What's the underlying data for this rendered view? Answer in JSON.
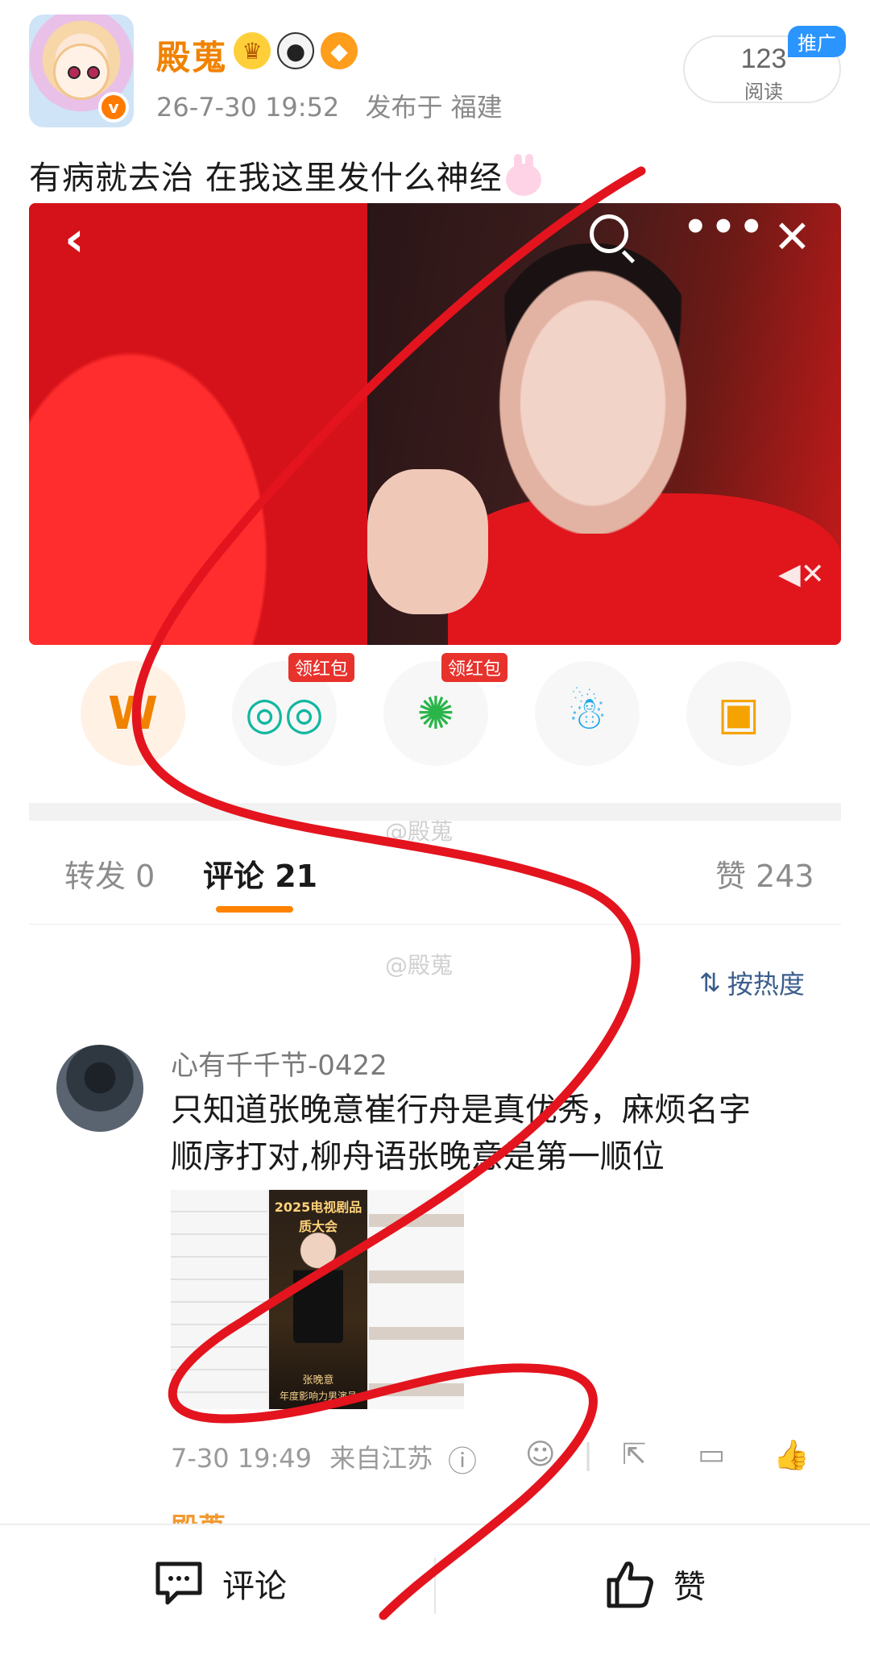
{
  "post": {
    "username": "殿蒐",
    "time": "26-7-30 19:52",
    "location": "发布于 福建",
    "reads_count": "123",
    "reads_label": "阅读",
    "promo_tag": "推广",
    "text": "有病就去治 在我这里发什么神经",
    "icons": [
      "crown-icon",
      "panda-icon",
      "fish-icon",
      "bunny-emoji"
    ]
  },
  "video": {
    "icons": [
      "back-icon",
      "search-icon",
      "more-icon",
      "close-icon",
      "mute-icon"
    ]
  },
  "share": {
    "red_packet_label": "领红包",
    "items": [
      "weibo-share-icon",
      "wechat-icon",
      "moments-icon",
      "qq-icon",
      "save-image-icon"
    ]
  },
  "watermark": "@殿蒐",
  "tabs": {
    "repost": "转发 0",
    "comments": "评论 21",
    "likes": "赞 243"
  },
  "sort_label": "按热度",
  "comment": {
    "username": "心有千千节-0422",
    "text_line1": "只知道张晚意崔行舟是真优秀，麻烦名字",
    "text_line2": "顺序打对,柳舟语张晚意是第一顺位",
    "image_header": "2025电视剧品质大会",
    "image_caption1": "张晚意",
    "image_caption2": "年度影响力男演员",
    "time": "7-30 19:49",
    "location": "来自江苏"
  },
  "next_comment_peek": "殿蒐",
  "bottom_bar": {
    "comment_label": "评论",
    "like_label": "赞"
  },
  "colors": {
    "brand_orange": "#f08200",
    "tab_underline": "#ff8200",
    "link_blue": "#3a5d8c",
    "red_packet": "#e8322c",
    "scribble_red": "#e3141e"
  }
}
